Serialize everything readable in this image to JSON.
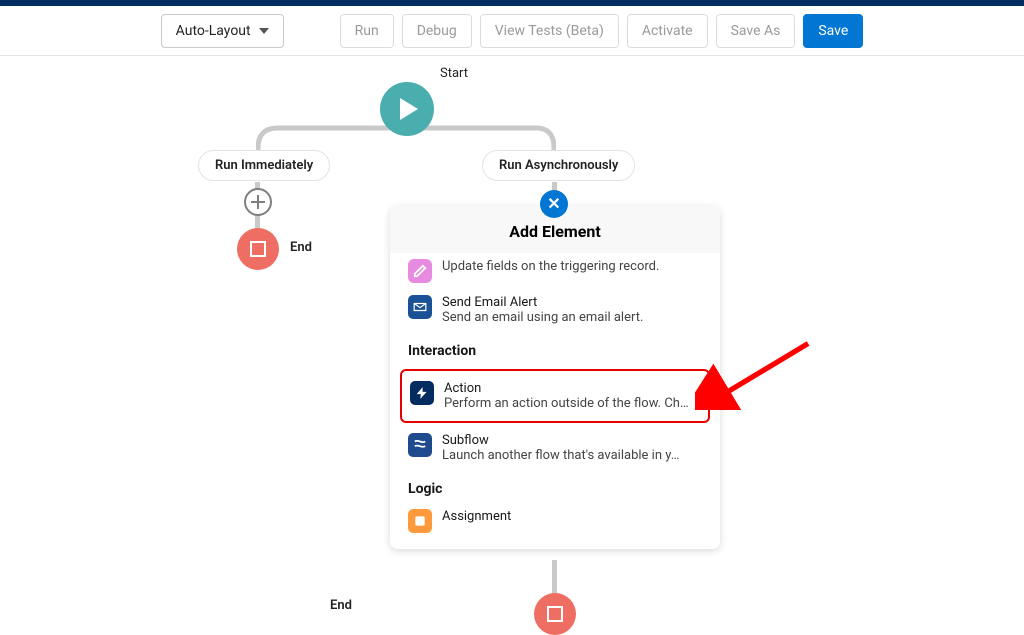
{
  "toolbar": {
    "layout_mode": "Auto-Layout",
    "run": "Run",
    "debug": "Debug",
    "view_tests": "View Tests (Beta)",
    "activate": "Activate",
    "save_as": "Save As",
    "save": "Save"
  },
  "flow": {
    "caption": "Start",
    "path_left": "Run Immediately",
    "path_right": "Run Asynchronously",
    "end_label_1": "End",
    "end_label_2": "End"
  },
  "panel": {
    "title": "Add Element",
    "top_item": {
      "desc": "Update fields on the triggering record."
    },
    "email_item": {
      "label": "Send Email Alert",
      "desc": "Send an email using an email alert."
    },
    "section_interaction": "Interaction",
    "action_item": {
      "label": "Action",
      "desc": "Perform an action outside of the flow. Ch…"
    },
    "subflow_item": {
      "label": "Subflow",
      "desc": "Launch another flow that's available in y…"
    },
    "section_logic": "Logic",
    "assignment_item": {
      "label": "Assignment"
    }
  }
}
